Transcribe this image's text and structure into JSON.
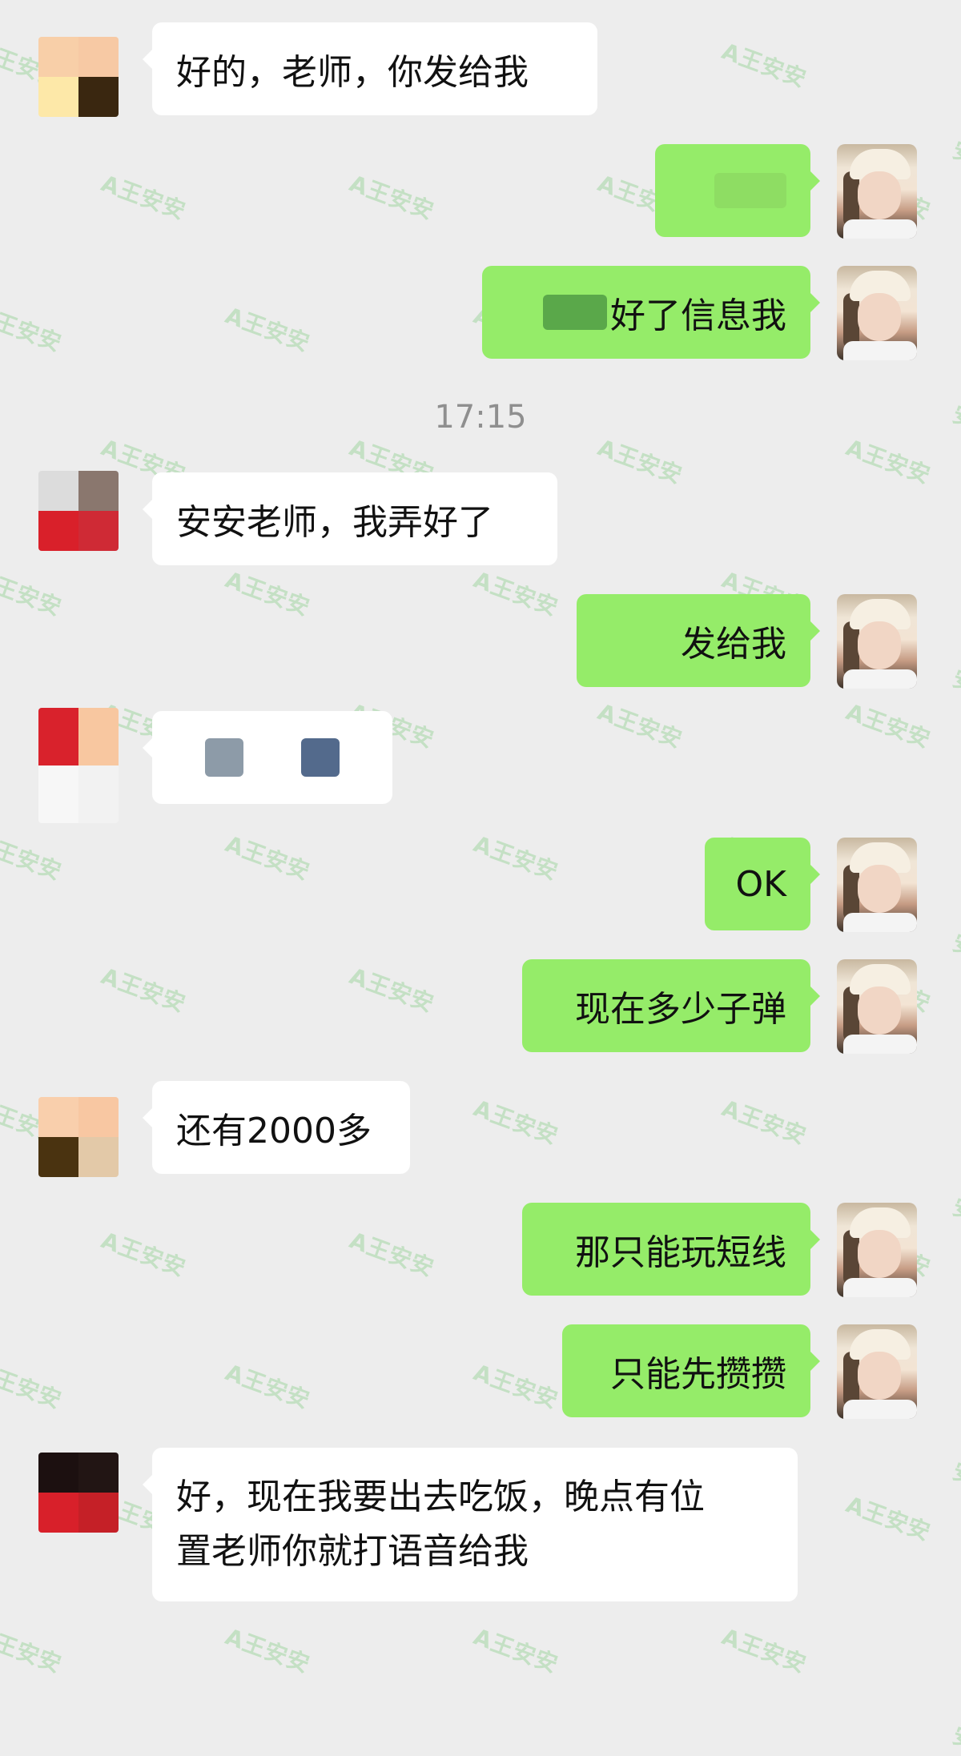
{
  "watermark": "A王安安",
  "timestamp": "17:15",
  "messages": [
    {
      "side": "in",
      "text": "好的，老师，你发给我",
      "avatar": [
        "#f8cfa8",
        "#f7c9a4",
        "#fde8a8",
        "#3a2710"
      ]
    },
    {
      "side": "out",
      "text": ""
    },
    {
      "side": "out",
      "text": "好了信息我"
    },
    {
      "side": "in",
      "text": "安安老师，我弄好了",
      "avatar": [
        "#dcdcdc",
        "#8a776e",
        "#d9202a",
        "#cf2a35"
      ]
    },
    {
      "side": "out",
      "text": "发给我"
    },
    {
      "side": "in",
      "text": "",
      "avatar": [
        "#d9222c",
        "#f8c7a0",
        "#f7f7f7",
        "#f2f2f2"
      ]
    },
    {
      "side": "out",
      "text": "OK"
    },
    {
      "side": "out",
      "text": "现在多少子弹"
    },
    {
      "side": "in",
      "text": "还有2000多",
      "avatar": [
        "#f9cfac",
        "#f8c7a2",
        "#4a3310",
        "#e3c9a8"
      ]
    },
    {
      "side": "out",
      "text": "那只能玩短线"
    },
    {
      "side": "out",
      "text": "只能先攒攒"
    },
    {
      "side": "in",
      "text": "好，现在我要出去吃饭，晚点有位置老师你就打语音给我",
      "lines": [
        "好，现在我要出去吃饭，晚点有位",
        "置老师你就打语音给我"
      ],
      "avatar": [
        "#1c1010",
        "#221514",
        "#d8202a",
        "#c52027"
      ]
    }
  ],
  "colors": {
    "background": "#ededed",
    "bubble_in": "#ffffff",
    "bubble_out": "#95ec69"
  }
}
